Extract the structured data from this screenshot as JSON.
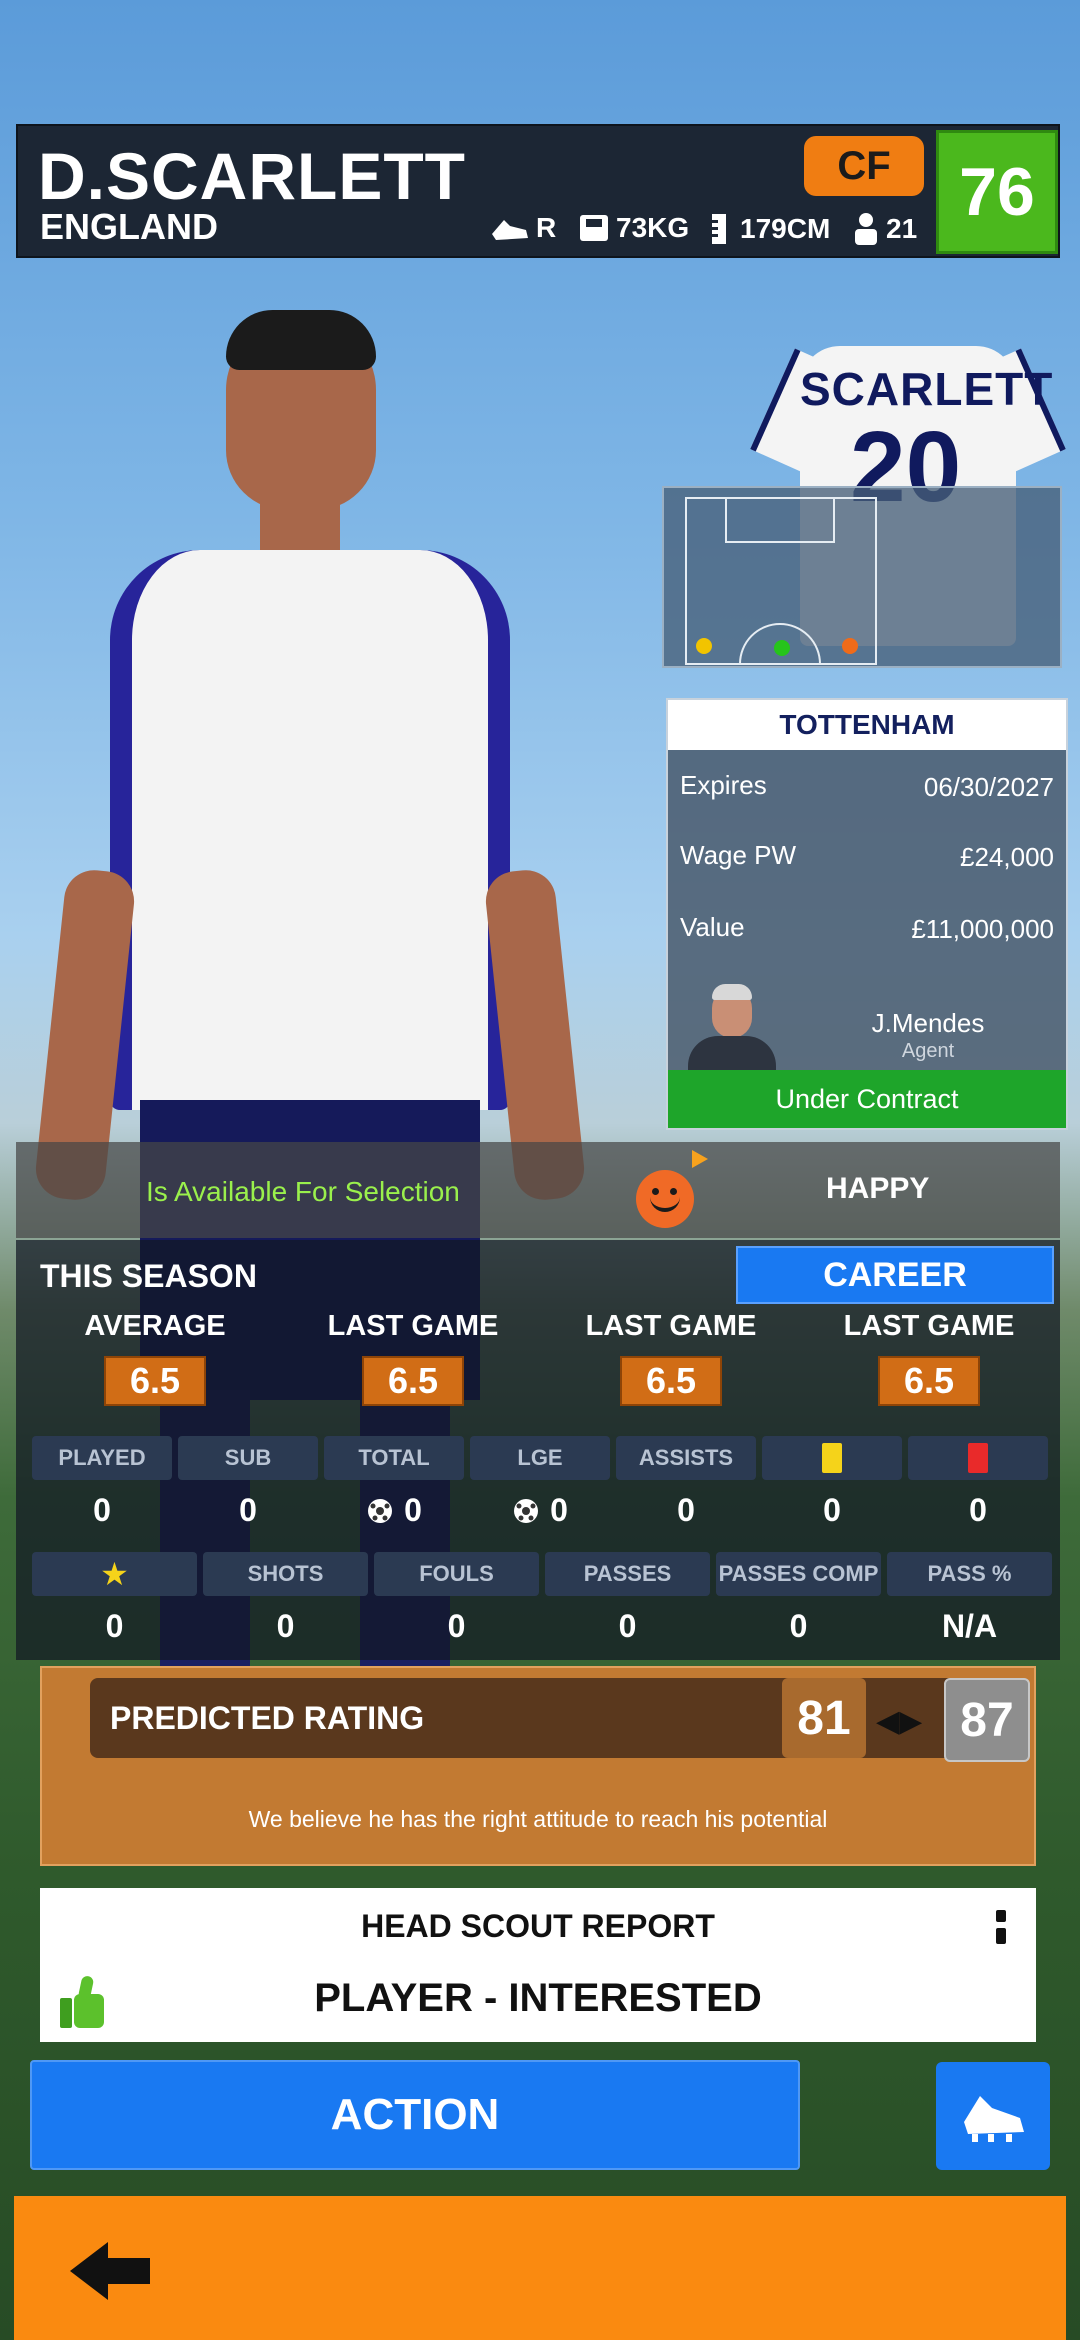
{
  "player": {
    "name": "D.SCARLETT",
    "nation": "ENGLAND",
    "position": "CF",
    "overall": "76",
    "foot": "R",
    "weight": "73KG",
    "height": "179CM",
    "age": "21",
    "shirt_name": "SCARLETT",
    "shirt_number": "20"
  },
  "club": {
    "name": "TOTTENHAM",
    "rows": [
      {
        "label": "Expires",
        "value": "06/30/2027"
      },
      {
        "label": "Wage PW",
        "value": "£24,000"
      },
      {
        "label": "Value",
        "value": "£11,000,000"
      }
    ],
    "agent_name": "J.Mendes",
    "agent_role": "Agent",
    "contract_status": "Under Contract"
  },
  "availability": {
    "text": "Is Available For Selection",
    "mood": "HAPPY"
  },
  "season": {
    "title": "THIS SEASON",
    "career_label": "CAREER",
    "ratings": [
      {
        "label": "AVERAGE",
        "value": "6.5"
      },
      {
        "label": "LAST GAME",
        "value": "6.5"
      },
      {
        "label": "LAST GAME",
        "value": "6.5"
      },
      {
        "label": "LAST GAME",
        "value": "6.5"
      }
    ],
    "row1": [
      {
        "label": "PLAYED",
        "value": "0"
      },
      {
        "label": "SUB",
        "value": "0"
      },
      {
        "label": "TOTAL",
        "value": "0"
      },
      {
        "label": "LGE",
        "value": "0"
      },
      {
        "label": "ASSISTS",
        "value": "0"
      },
      {
        "label": "",
        "value": "0"
      },
      {
        "label": "",
        "value": "0"
      }
    ],
    "row2": [
      {
        "label": "",
        "value": "0"
      },
      {
        "label": "SHOTS",
        "value": "0"
      },
      {
        "label": "FOULS",
        "value": "0"
      },
      {
        "label": "PASSES",
        "value": "0"
      },
      {
        "label": "PASSES COMP",
        "value": "0"
      },
      {
        "label": "PASS %",
        "value": "N/A"
      }
    ]
  },
  "prediction": {
    "label": "PREDICTED RATING",
    "min": "81",
    "max": "87",
    "note": "We believe he has the right attitude to reach his potential"
  },
  "scout": {
    "title": "HEAD SCOUT REPORT",
    "result": "PLAYER - INTERESTED"
  },
  "actions": {
    "action_label": "ACTION"
  },
  "colors": {
    "accent_blue": "#1979f2",
    "accent_orange": "#fa8a10",
    "rating_green": "#4bb81d",
    "available_green": "#9af04c"
  }
}
